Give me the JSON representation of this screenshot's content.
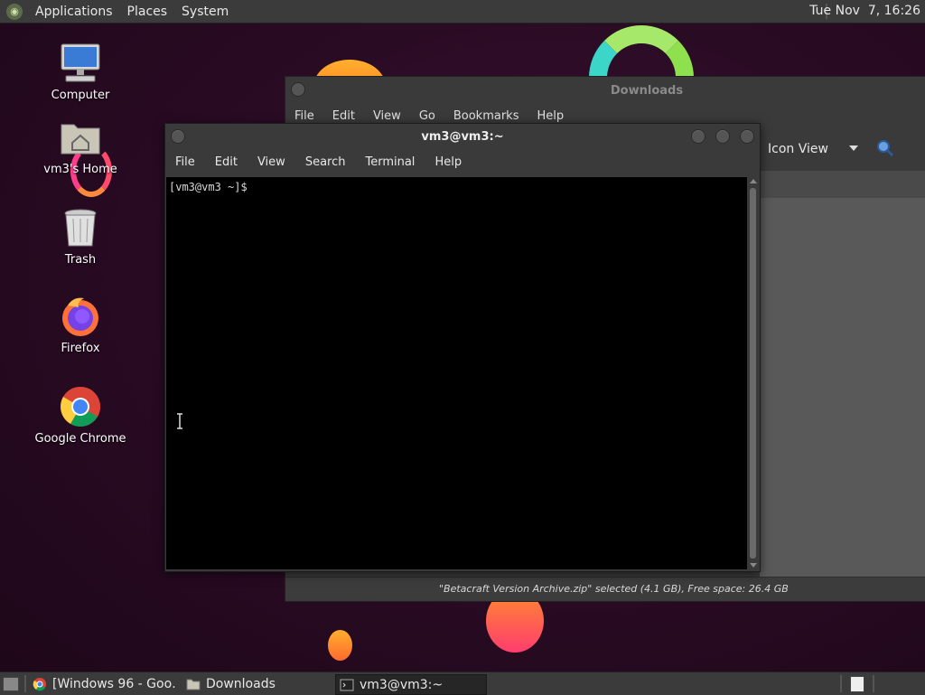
{
  "top_panel": {
    "menus": [
      "Applications",
      "Places",
      "System"
    ],
    "clock": "Tue Nov  7, 16:26"
  },
  "desktop_icons": [
    {
      "label": "Computer",
      "icon": "computer-icon"
    },
    {
      "label": "vm3's Home",
      "icon": "home-folder-icon"
    },
    {
      "label": "Trash",
      "icon": "trash-icon"
    },
    {
      "label": "Firefox",
      "icon": "firefox-icon"
    },
    {
      "label": "Google Chrome",
      "icon": "chrome-icon"
    }
  ],
  "file_manager": {
    "title": "Downloads",
    "menus": [
      "File",
      "Edit",
      "View",
      "Go",
      "Bookmarks",
      "Help"
    ],
    "view_mode": "Icon View",
    "status": "\"Betacraft Version Archive.zip\" selected (4.1 GB), Free space: 26.4 GB"
  },
  "terminal": {
    "title": "vm3@vm3:~",
    "menus": [
      "File",
      "Edit",
      "View",
      "Search",
      "Terminal",
      "Help"
    ],
    "prompt": "[vm3@vm3 ~]$"
  },
  "taskbar": {
    "tasks": [
      {
        "label": "[Windows 96 - Goo…",
        "icon": "chrome-icon",
        "active": false
      },
      {
        "label": "Downloads",
        "icon": "folder-icon",
        "active": false
      },
      {
        "label": "vm3@vm3:~",
        "icon": "terminal-icon",
        "active": true
      }
    ]
  },
  "colors": {
    "desktop_bg": "#2a0b24",
    "panel_bg": "#3b3b3b",
    "terminal_bg": "#000000"
  }
}
